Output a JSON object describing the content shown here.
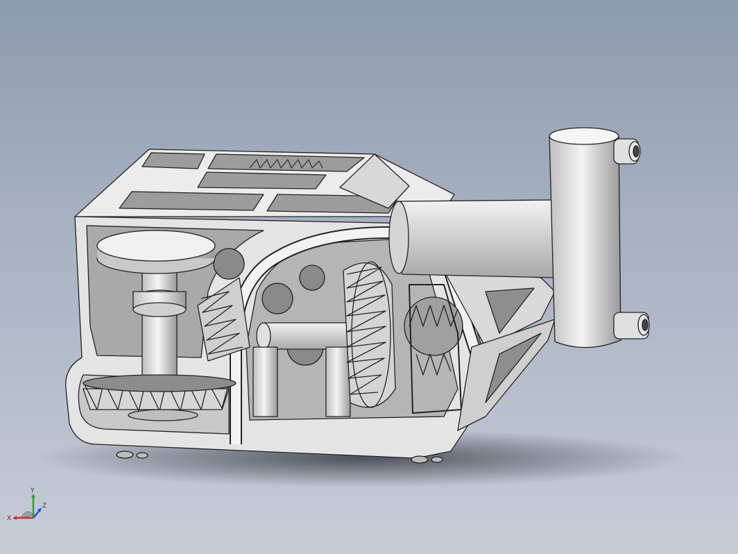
{
  "viewport": {
    "background_top": "#8d9bb0",
    "background_bottom": "#c7ccd6",
    "model_color": "#e6e6e6"
  },
  "triad": {
    "x_label": "X",
    "y_label": "Y",
    "z_label": "Z",
    "x_color": "#d42a2a",
    "y_color": "#2aa52a",
    "z_color": "#2a4fd4"
  }
}
